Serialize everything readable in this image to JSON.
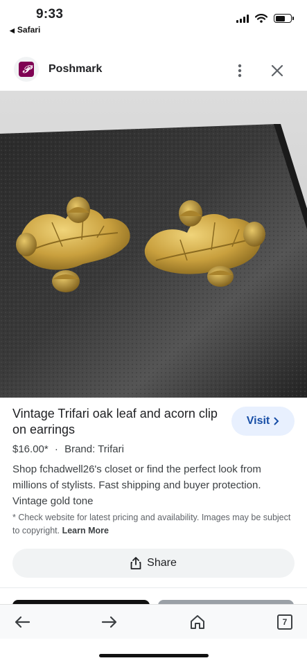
{
  "status_bar": {
    "time": "9:33",
    "back_app": "Safari",
    "icons": [
      "signal-icon",
      "wifi-icon",
      "battery-icon"
    ]
  },
  "header": {
    "site_name": "Poshmark",
    "logo_icon": "poshmark-logo",
    "logo_color": "#7f0353",
    "more_icon": "more-vertical-icon",
    "close_icon": "close-icon"
  },
  "product": {
    "image_description_icon": "product-photo",
    "title": "Vintage Trifari oak leaf and acorn clip on earrings",
    "price": "$16.00*",
    "separator": "·",
    "brand": "Brand: Trifari",
    "description": "Shop fchadwell26's closet or find the perfect look from millions of stylists. Fast shipping and buyer protection. Vintage gold tone",
    "disclaimer": "* Check website for latest pricing and availability. Images may be subject to copyright.",
    "learn_more": "Learn More"
  },
  "actions": {
    "visit_label": "Visit",
    "share_label": "Share"
  },
  "toolbar": {
    "back_icon": "arrow-left-icon",
    "forward_icon": "arrow-right-icon",
    "home_icon": "home-icon",
    "tab_count": "7"
  },
  "colors": {
    "accent_blue": "#174ea6",
    "visit_bg": "#e8f0fe",
    "share_bg": "#f1f3f4"
  }
}
